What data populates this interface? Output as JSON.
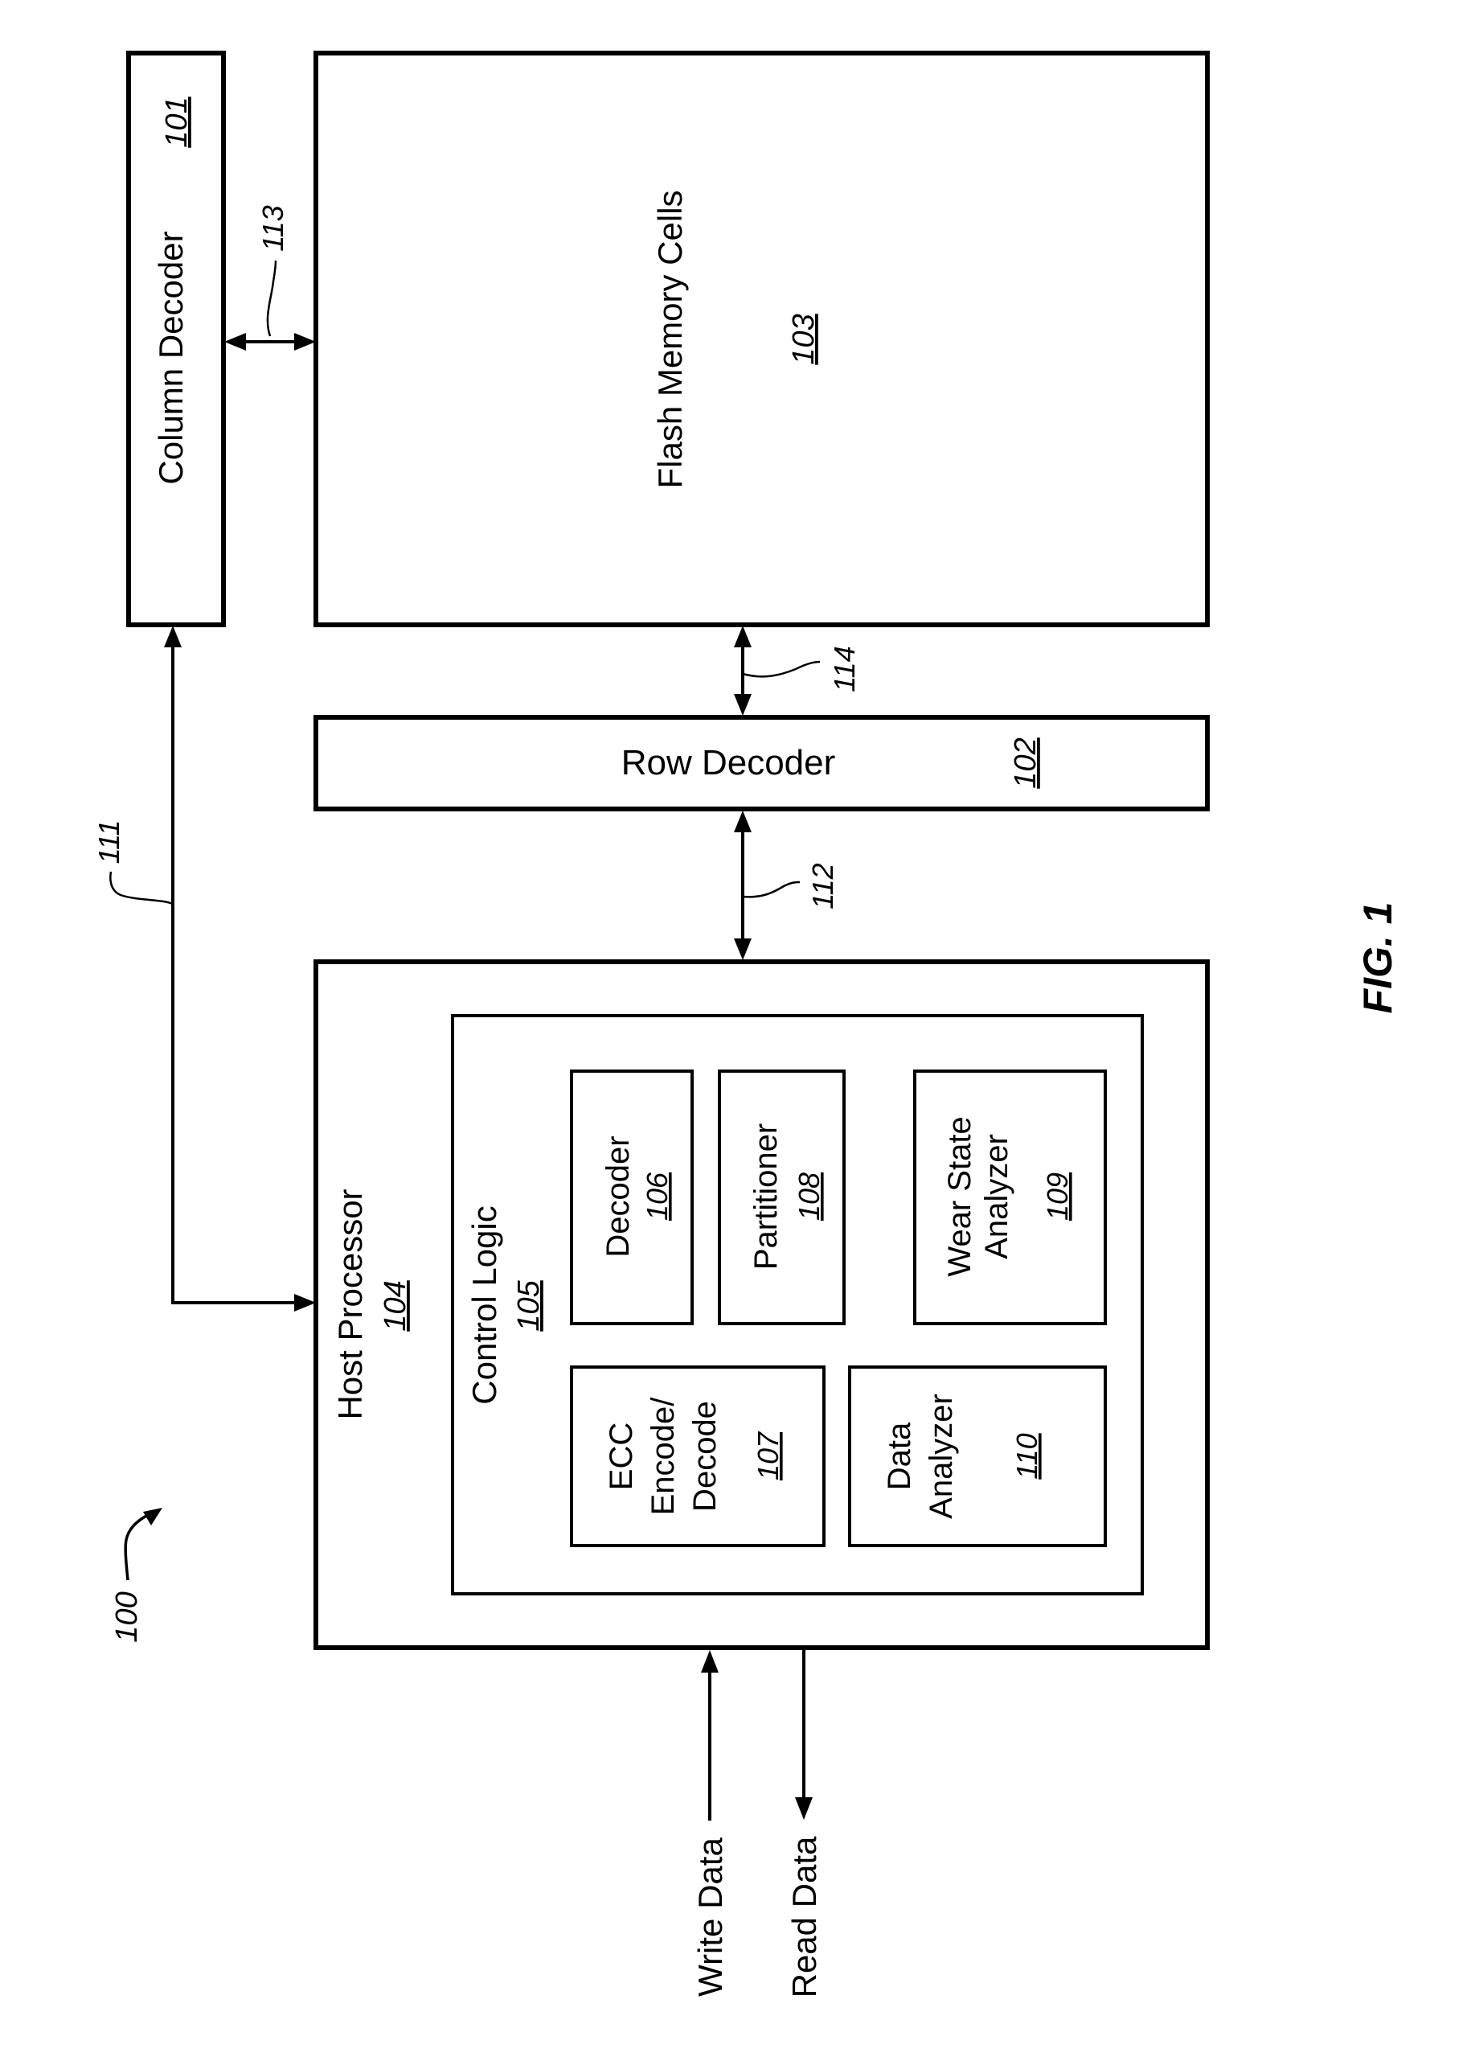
{
  "figure": {
    "title": "FIG. 1",
    "system_ref": "100"
  },
  "blocks": {
    "column_decoder": {
      "label": "Column Decoder",
      "ref": "101"
    },
    "row_decoder": {
      "label": "Row Decoder",
      "ref": "102"
    },
    "flash_memory": {
      "label": "Flash Memory Cells",
      "ref": "103"
    },
    "host_processor": {
      "label": "Host Processor",
      "ref": "104"
    },
    "control_logic": {
      "label": "Control Logic",
      "ref": "105"
    },
    "decoder": {
      "label": "Decoder",
      "ref": "106"
    },
    "ecc": {
      "lines": [
        "ECC",
        "Encode/",
        "Decode"
      ],
      "ref": "107"
    },
    "partitioner": {
      "label": "Partitioner",
      "ref": "108"
    },
    "wear_state_analyzer": {
      "lines": [
        "Wear State",
        "Analyzer"
      ],
      "ref": "109"
    },
    "data_analyzer": {
      "lines": [
        "Data",
        "Analyzer"
      ],
      "ref": "110"
    }
  },
  "buses": {
    "host_to_column": "111",
    "host_to_row": "112",
    "column_to_flash": "113",
    "row_to_flash": "114"
  },
  "io": {
    "write": "Write Data",
    "read": "Read Data"
  }
}
